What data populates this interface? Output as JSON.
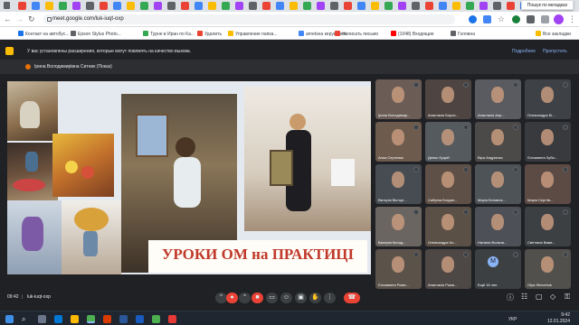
{
  "browser": {
    "tabs_count": 38,
    "url": "meet.google.com/luk-iuqt-oxp",
    "tooltip": "Пошук по вкладках",
    "bookmarks": [
      "Контакт на автобус...",
      "Epson Stylus Photo...",
      "Турне в Иран по Ка...",
      "Удалить",
      "Управление папка...",
      "ametxea керування",
      "Написать письмо",
      "(1048) Входящие",
      "Головна"
    ],
    "all_bookmarks": "Все закладки"
  },
  "notice": {
    "text": "У вас установлены расширения, которые могут повлиять на качество вызова.",
    "details_label": "Подробнее",
    "skip_label": "Пропустить"
  },
  "presenter": {
    "name": "Ірина Володимирівна Ситник (Показ)"
  },
  "slide": {
    "caption": "УРОКИ ОМ на ПРАКТИЦІ"
  },
  "participants": [
    {
      "name": "Ірина Володимир..."
    },
    {
      "name": "Анастасія Борис..."
    },
    {
      "name": "Анастасія Апр..."
    },
    {
      "name": "Олександра Бі..."
    },
    {
      "name": "Анна Сергеєва"
    },
    {
      "name": "Денис Куций"
    },
    {
      "name": "Віра Андрієнко"
    },
    {
      "name": "Єлизавета Зуба..."
    },
    {
      "name": "Вікторія Вікторі..."
    },
    {
      "name": "Сабріна Богдан..."
    },
    {
      "name": "Марія Біловичі..."
    },
    {
      "name": "Марія Сергіїв..."
    },
    {
      "name": "Валерія Колод..."
    },
    {
      "name": "Олександра Ко..."
    },
    {
      "name": "Наталія Волков..."
    },
    {
      "name": "Світлана Ваків..."
    },
    {
      "name": "Єлизавета Рома..."
    },
    {
      "name": "Анастасія Рома..."
    },
    {
      "name": "Ещё 16 чел."
    },
    {
      "name": "Olya Shevchuk"
    }
  ],
  "meeting": {
    "time": "09:42",
    "code": "luk-iuqt-oxp"
  },
  "taskbar": {
    "time": "9:42",
    "date": "12.01.2024",
    "lang": "УКР"
  }
}
